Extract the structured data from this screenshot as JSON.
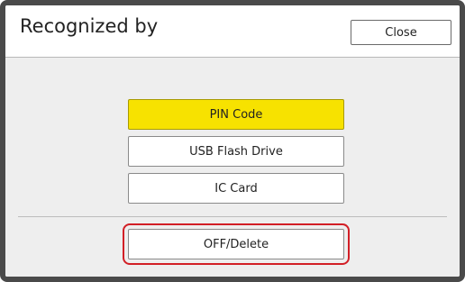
{
  "header": {
    "title": "Recognized by",
    "close_label": "Close"
  },
  "options": [
    {
      "label": "PIN Code",
      "selected": true
    },
    {
      "label": "USB Flash Drive",
      "selected": false
    },
    {
      "label": "IC Card",
      "selected": false
    }
  ],
  "off_delete_label": "OFF/Delete",
  "colors": {
    "selected": "#f7e200",
    "highlight": "#d21f26",
    "panel_background": "#eeeeee"
  }
}
